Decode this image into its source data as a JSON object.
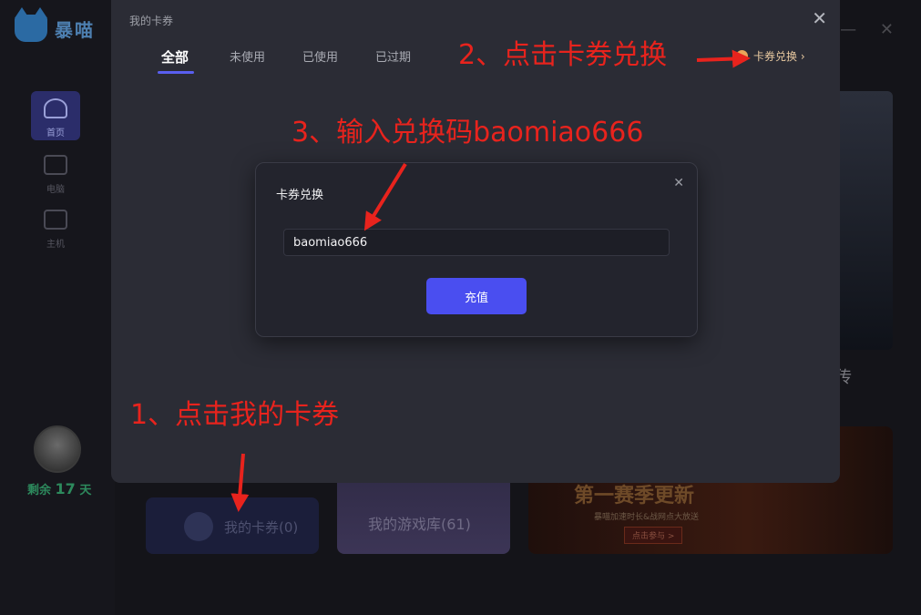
{
  "app": {
    "brand": "暴喵",
    "nav": [
      {
        "label": "首页",
        "icon": "home-icon",
        "active": true
      },
      {
        "label": "电脑",
        "icon": "monitor-icon"
      },
      {
        "label": "主机",
        "icon": "gamepad-icon"
      }
    ],
    "remaining": {
      "prefix": "剩余",
      "value": "17",
      "unit": "天"
    },
    "banner_right_text": "传",
    "cards": {
      "coupons": "我的卡券(0)",
      "games": "我的游戏库(61)",
      "season": {
        "title": "第一赛季更新",
        "subtitle": "暴喵加速时长&战网点大放送",
        "button": "点击参与 >"
      }
    }
  },
  "dialog": {
    "title": "我的卡券",
    "tabs": [
      "全部",
      "未使用",
      "已使用",
      "已过期"
    ],
    "active_tab": "全部",
    "redeem_link": "卡券兑换 ›"
  },
  "redeem_modal": {
    "title": "卡券兑换",
    "input_value": "baomiao666",
    "button": "充值"
  },
  "annotations": {
    "step1": "1、点击我的卡券",
    "step2": "2、点击卡券兑换",
    "step3": "3、输入兑换码baomiao666"
  },
  "colors": {
    "accent": "#4a4ef0",
    "annotation": "#e8231d",
    "dialog_bg": "#2b2c35",
    "modal_bg": "#23242d"
  }
}
